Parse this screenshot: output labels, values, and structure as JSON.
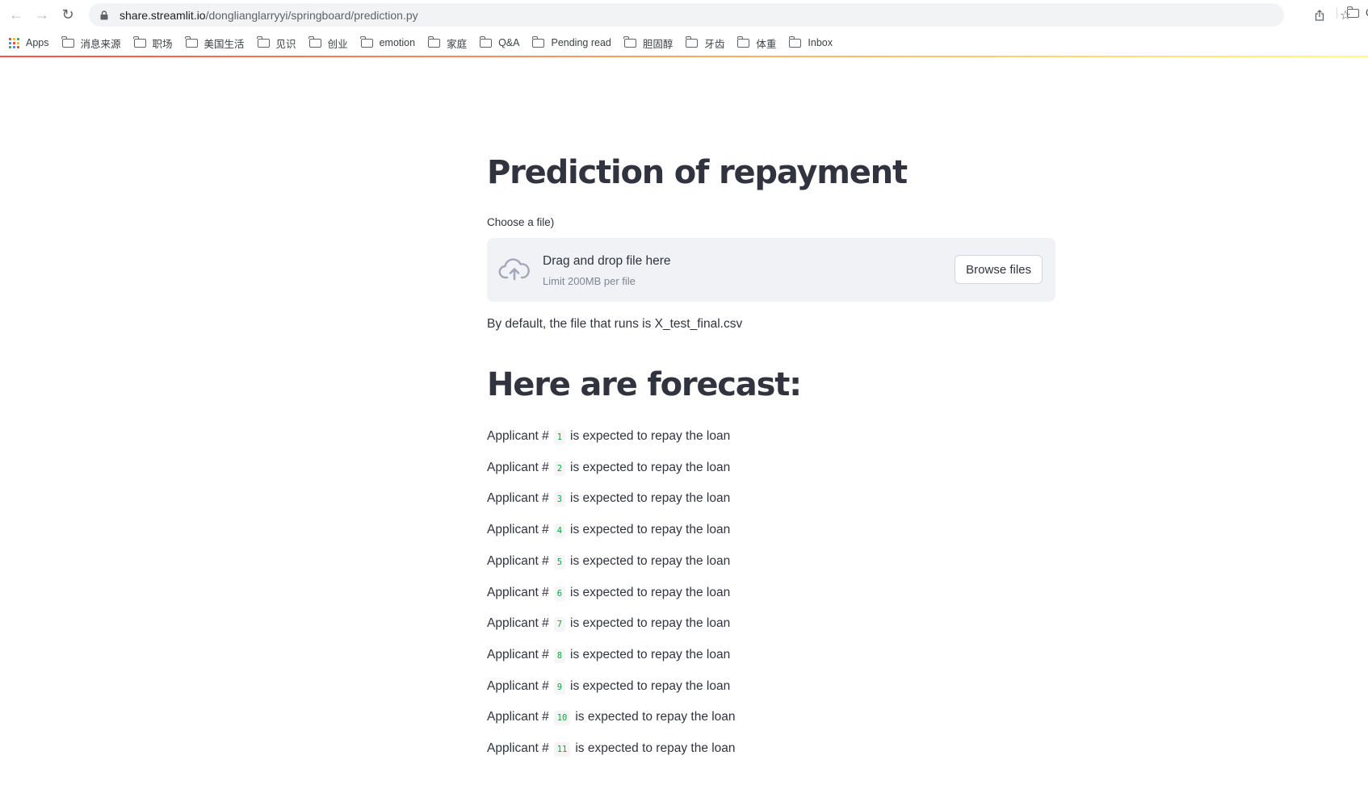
{
  "browser": {
    "url_host": "share.streamlit.io",
    "url_path": "/donglianglarryyi/springboard/prediction.py",
    "bookmarks": [
      {
        "label": "Apps",
        "icon": "apps-grid-icon"
      },
      {
        "label": "消息来源",
        "icon": "folder-icon"
      },
      {
        "label": "职场",
        "icon": "folder-icon"
      },
      {
        "label": "美国生活",
        "icon": "folder-icon"
      },
      {
        "label": "见识",
        "icon": "folder-icon"
      },
      {
        "label": "创业",
        "icon": "folder-icon"
      },
      {
        "label": "emotion",
        "icon": "folder-icon"
      },
      {
        "label": "家庭",
        "icon": "folder-icon"
      },
      {
        "label": "Q&A",
        "icon": "folder-icon"
      },
      {
        "label": "Pending read",
        "icon": "folder-icon"
      },
      {
        "label": "胆固醇",
        "icon": "folder-icon"
      },
      {
        "label": "牙齿",
        "icon": "folder-icon"
      },
      {
        "label": "体重",
        "icon": "folder-icon"
      },
      {
        "label": "Inbox",
        "icon": "folder-icon"
      }
    ],
    "bookmarks_overflow": "C"
  },
  "colors": {
    "accent_red": "#ff4b4b",
    "accent_yellow": "#fffd80",
    "code_green": "#09ab3b",
    "text": "#31333f",
    "dropzone_bg": "#f0f2f6"
  },
  "app": {
    "title": "Prediction of repayment",
    "uploader": {
      "label": "Choose a file)",
      "drop_text": "Drag and drop file here",
      "limit_text": "Limit 200MB per file",
      "browse_label": "Browse files",
      "icon": "cloud-upload-icon"
    },
    "default_note": "By default, the file that runs is X_test_final.csv",
    "forecast_heading": "Here are forecast:",
    "forecast_prefix": "Applicant #",
    "forecast_suffix": "is expected to repay the loan",
    "forecast_ids": [
      "1",
      "2",
      "3",
      "4",
      "5",
      "6",
      "7",
      "8",
      "9",
      "10",
      "11"
    ]
  }
}
